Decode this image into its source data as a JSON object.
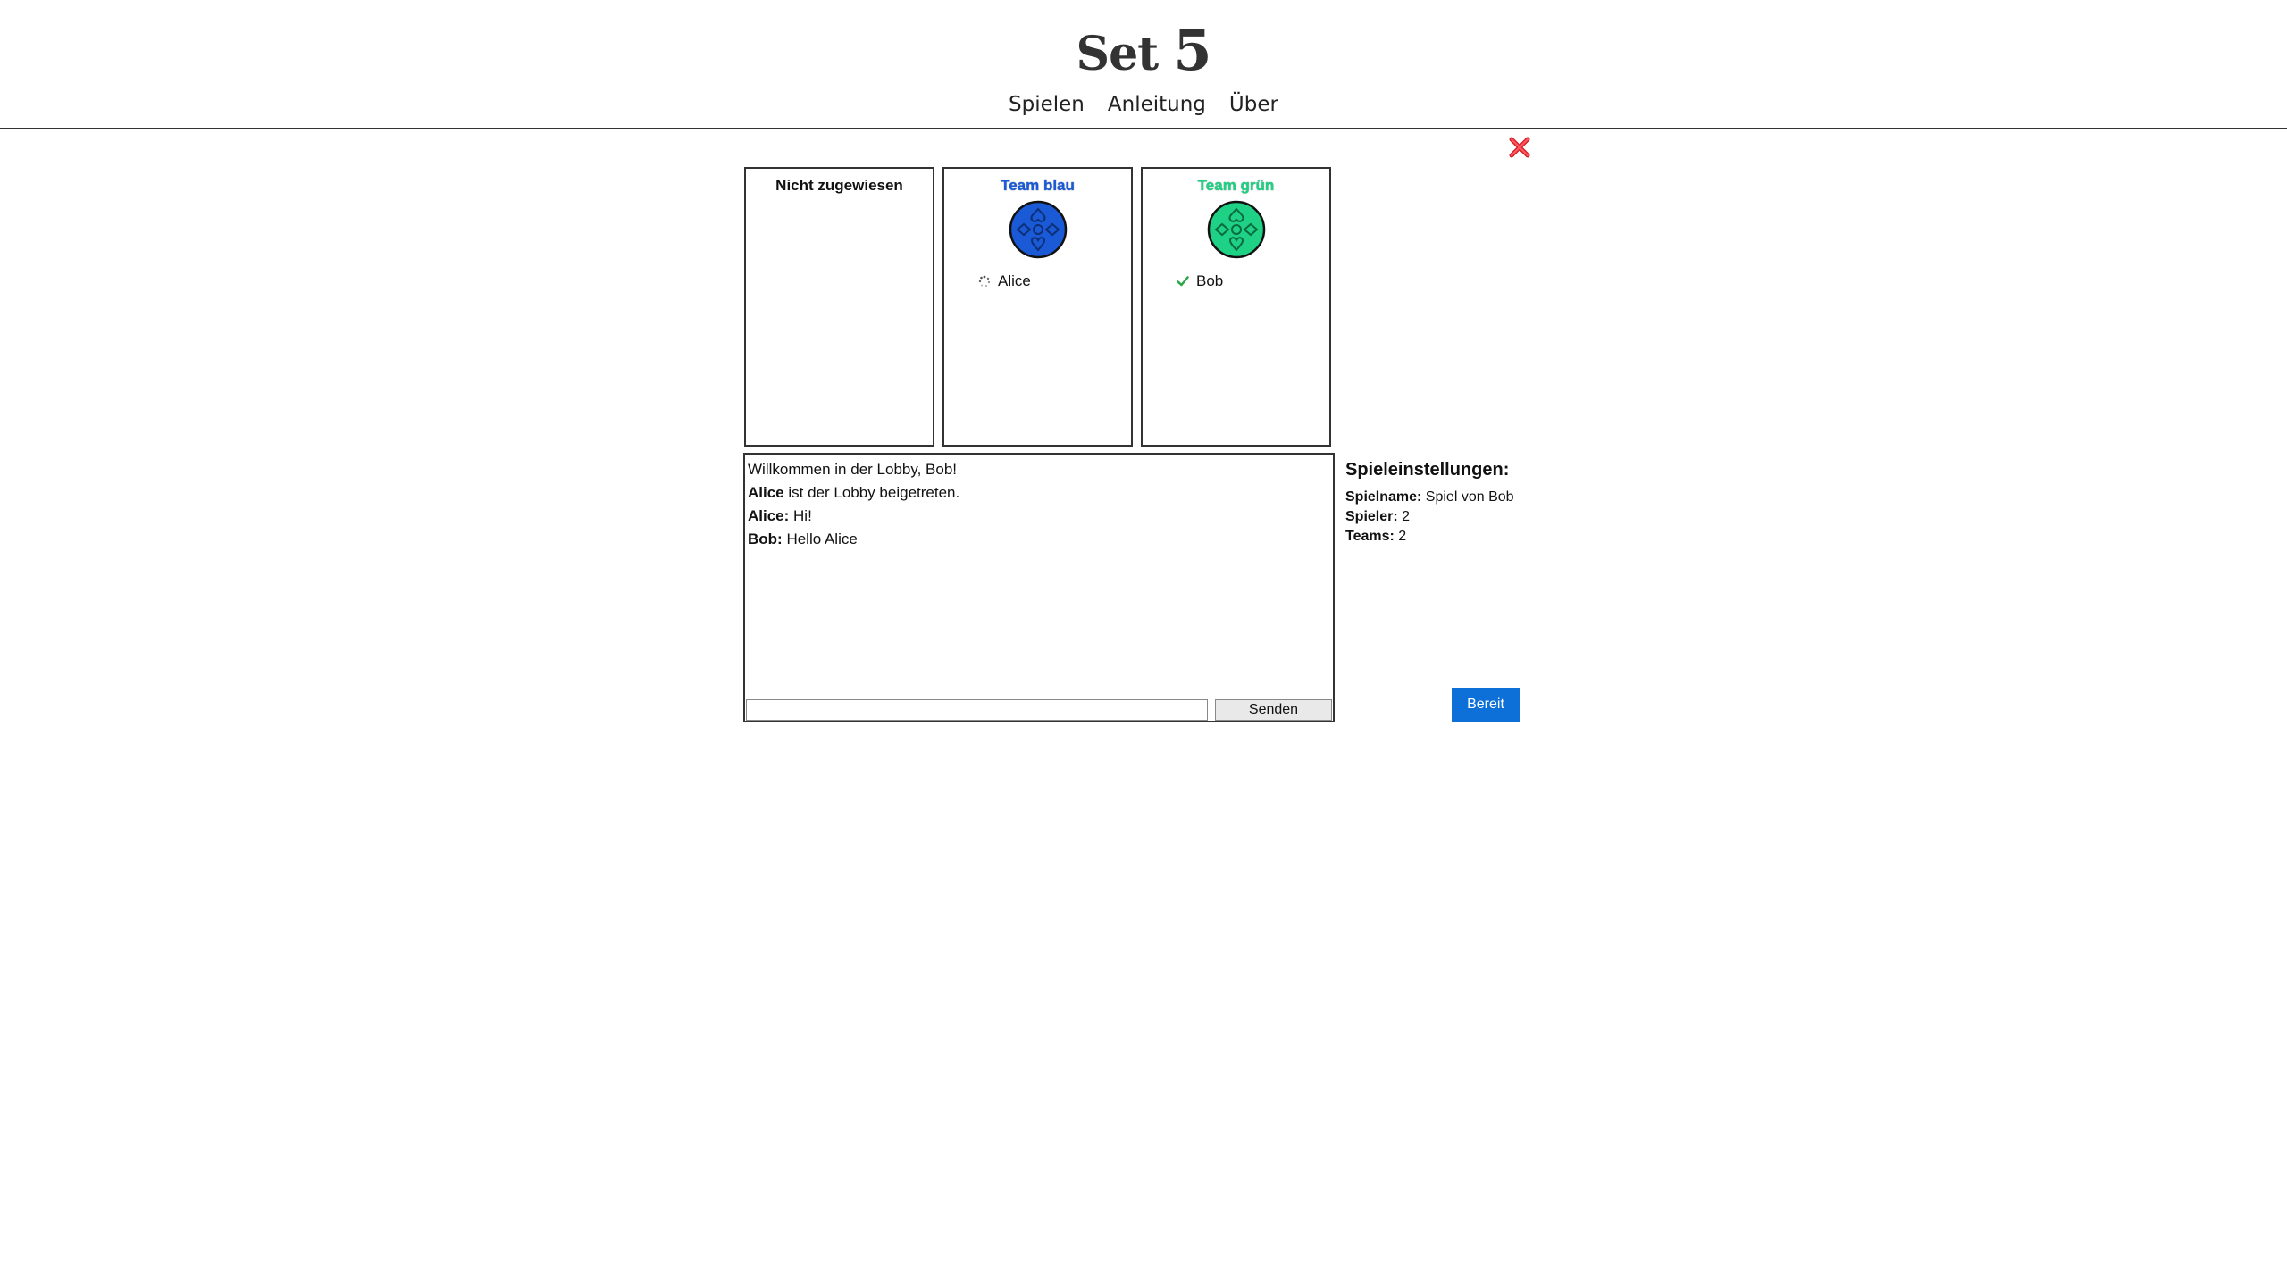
{
  "header": {
    "logo_text": "Set",
    "logo_number": "5",
    "nav": [
      "Spielen",
      "Anleitung",
      "Über"
    ]
  },
  "lobby": {
    "close_icon": "close-x-icon",
    "teams": [
      {
        "title": "Nicht zugewiesen",
        "players": []
      },
      {
        "title": "Team blau",
        "color": "#1a5ad6",
        "emblem": "card-suits-emblem",
        "players": [
          {
            "name": "Alice",
            "status": "loading-spinner-icon"
          }
        ]
      },
      {
        "title": "Team grün",
        "color": "#1fd184",
        "emblem": "card-suits-emblem",
        "players": [
          {
            "name": "Bob",
            "status": "check-icon"
          }
        ]
      }
    ]
  },
  "chat": {
    "messages": [
      {
        "sender": "",
        "text": "Willkommen in der Lobby, Bob!"
      },
      {
        "sender": "Alice",
        "text": " ist der Lobby beigetreten."
      },
      {
        "sender": "Alice:",
        "text": " Hi!"
      },
      {
        "sender": "Bob:",
        "text": " Hello Alice"
      }
    ],
    "input_value": "",
    "send_label": "Senden"
  },
  "settings": {
    "heading": "Spieleinstellungen:",
    "rows": [
      {
        "label": "Spielname:",
        "value": " Spiel von Bob"
      },
      {
        "label": "Spieler:",
        "value": " 2"
      },
      {
        "label": "Teams:",
        "value": " 2"
      }
    ],
    "ready_label": "Bereit"
  }
}
